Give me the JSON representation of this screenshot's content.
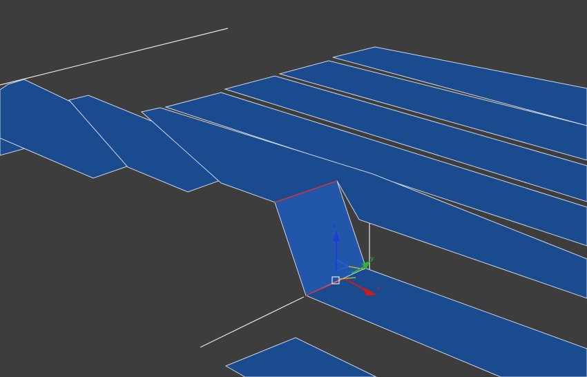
{
  "viewport": {
    "background_color": "#3d3d3d",
    "mesh_color": "#1a4b8f",
    "mesh_highlight_color": "#2156a8",
    "edge_color": "#cfd6e6",
    "selected_edge_color": "#d1303a",
    "wire_color": "#e8e8e8"
  },
  "gizmo": {
    "axes": [
      {
        "label": "z",
        "color": "#1a3fd8",
        "icon": "arrow-up-icon"
      },
      {
        "label": "y",
        "color": "#2fb52f",
        "icon": "arrow-right-icon"
      },
      {
        "label": "x",
        "color": "#d11919",
        "icon": "arrow-down-right-icon"
      }
    ],
    "pivot_icon": "pivot-square-icon"
  }
}
